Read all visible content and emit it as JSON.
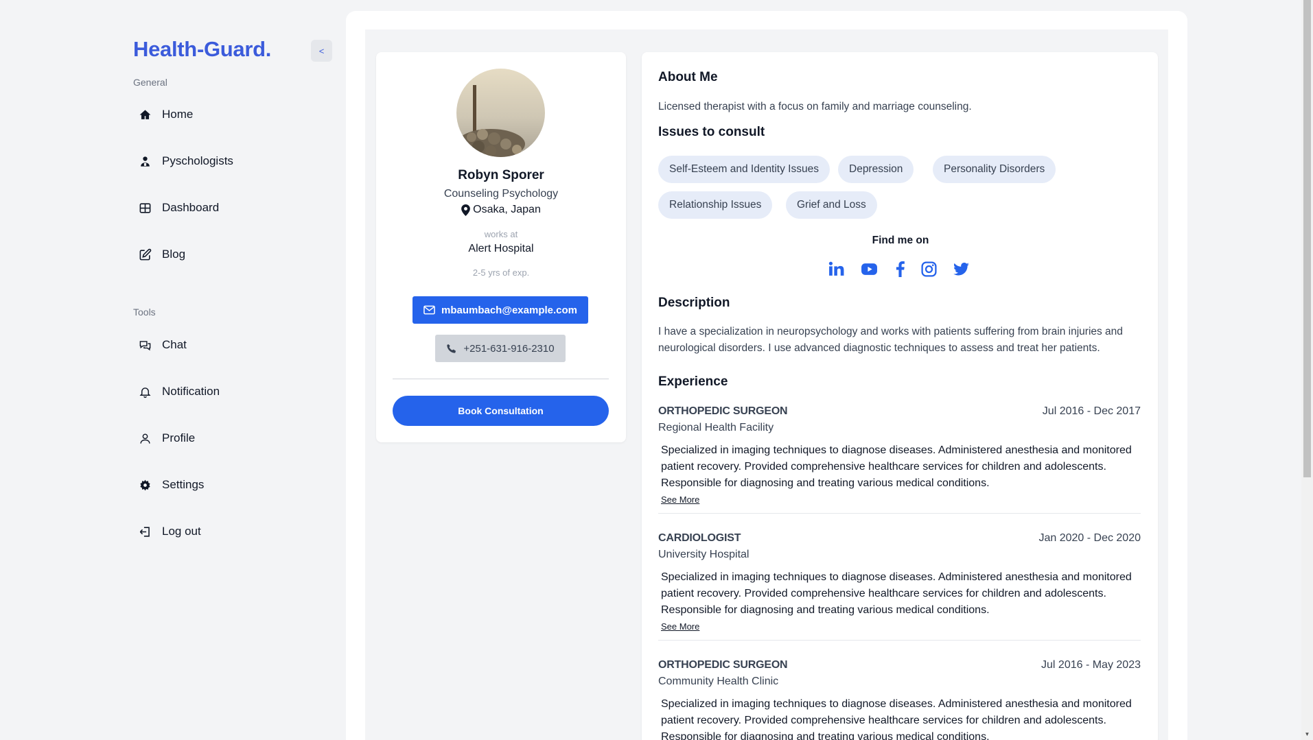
{
  "app": {
    "logo": "Health-Guard.",
    "collapse_label": "<"
  },
  "sidebar": {
    "general_label": "General",
    "tools_label": "Tools",
    "general_items": [
      {
        "label": "Home",
        "icon": "home-icon"
      },
      {
        "label": "Pyschologists",
        "icon": "user-icon"
      },
      {
        "label": "Dashboard",
        "icon": "grid-icon"
      },
      {
        "label": "Blog",
        "icon": "edit-icon"
      }
    ],
    "tool_items": [
      {
        "label": "Chat",
        "icon": "chat-icon"
      },
      {
        "label": "Notification",
        "icon": "bell-icon"
      },
      {
        "label": "Profile",
        "icon": "person-icon"
      },
      {
        "label": "Settings",
        "icon": "gear-icon"
      },
      {
        "label": "Log out",
        "icon": "logout-icon"
      }
    ]
  },
  "profile": {
    "name": "Robyn Sporer",
    "specialty": "Counseling Psychology",
    "location": "Osaka, Japan",
    "works_at_label": "works at",
    "hospital": "Alert Hospital",
    "experience": "2-5  yrs of exp.",
    "email": "mbaumbach@example.com",
    "phone": "+251-631-916-2310",
    "book_label": "Book Consultation"
  },
  "about": {
    "title": "About Me",
    "text": "Licensed therapist with a focus on family and marriage counseling."
  },
  "issues": {
    "title": "Issues to consult",
    "tags": [
      "Self-Esteem and Identity Issues",
      "Depression",
      "Personality Disorders",
      "Relationship Issues",
      "Grief and Loss"
    ]
  },
  "social": {
    "title": "Find me on",
    "links": [
      "linkedin-icon",
      "youtube-icon",
      "facebook-icon",
      "instagram-icon",
      "twitter-icon"
    ],
    "color": "#2563eb"
  },
  "description": {
    "title": "Description",
    "text": "I have a specialization in neuropsychology and works with patients suffering from brain injuries and neurological disorders. I use advanced diagnostic techniques to assess and treat her patients."
  },
  "experience": {
    "title": "Experience",
    "see_more": "See More",
    "items": [
      {
        "role": "ORTHOPEDIC SURGEON",
        "dates": "Jul 2016 - Dec 2017",
        "org": "Regional Health Facility",
        "desc": "Specialized in imaging techniques to diagnose diseases. Administered anesthesia and monitored patient recovery. Provided comprehensive healthcare services for children and adolescents. Responsible for diagnosing and treating various medical conditions."
      },
      {
        "role": "CARDIOLOGIST",
        "dates": "Jan 2020 - Dec 2020",
        "org": "University Hospital",
        "desc": "Specialized in imaging techniques to diagnose diseases. Administered anesthesia and monitored patient recovery. Provided comprehensive healthcare services for children and adolescents. Responsible for diagnosing and treating various medical conditions."
      },
      {
        "role": "ORTHOPEDIC SURGEON",
        "dates": "Jul 2016 - May 2023",
        "org": "Community Health Clinic",
        "desc": "Specialized in imaging techniques to diagnose diseases. Administered anesthesia and monitored patient recovery. Provided comprehensive healthcare services for children and adolescents. Responsible for diagnosing and treating various medical conditions."
      }
    ]
  },
  "colors": {
    "accent": "#2563eb",
    "logo": "#3b5bdb",
    "tag_bg": "#e6ecf8"
  }
}
